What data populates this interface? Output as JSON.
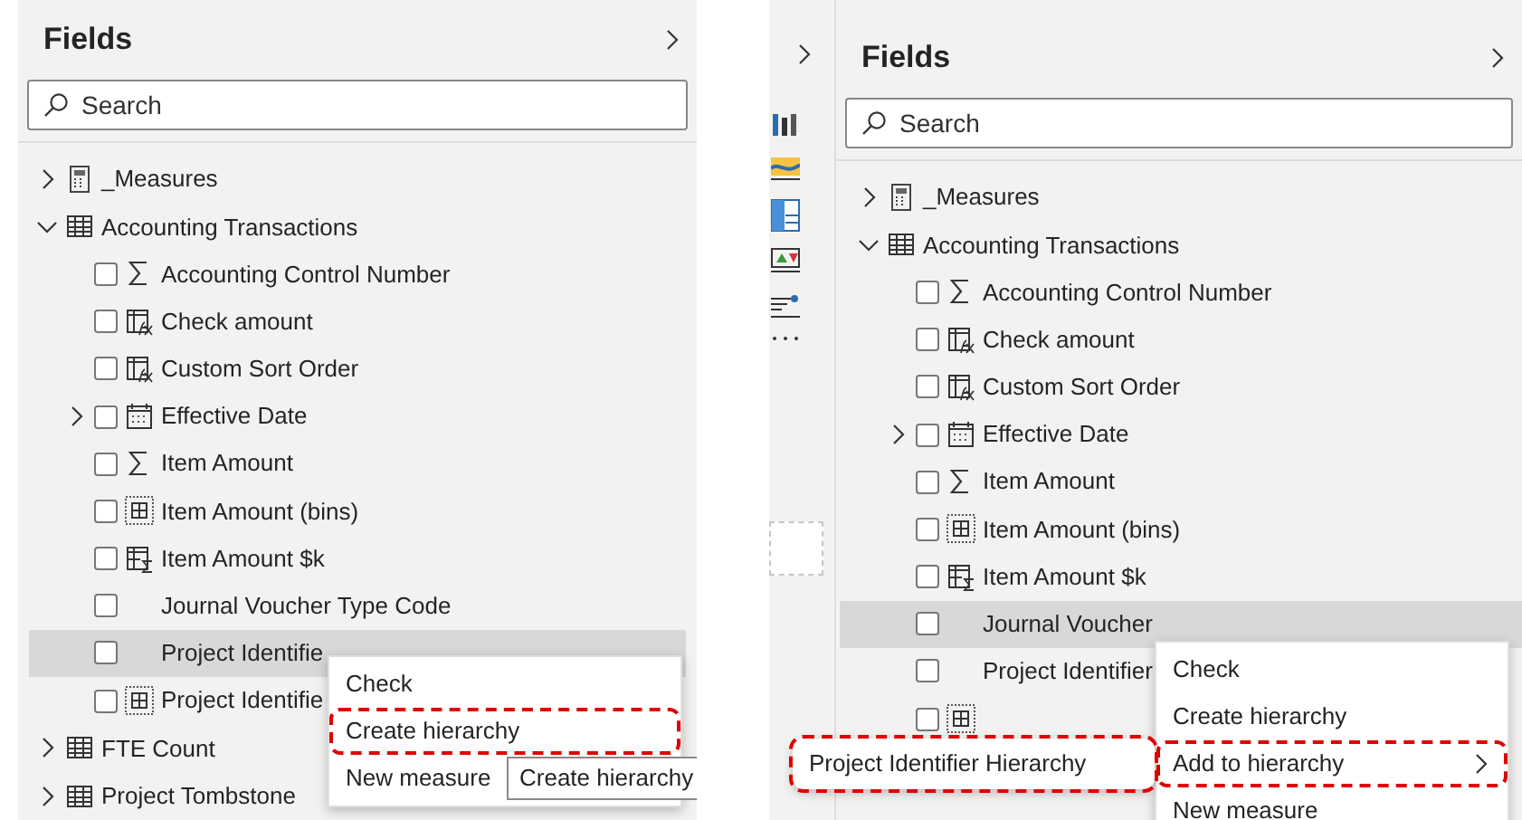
{
  "panels": [
    {
      "kind": "plain",
      "title": "Fields",
      "search": {
        "placeholder": "Search"
      },
      "tree": [
        {
          "label": "_Measures",
          "kind": "calculator",
          "expanded": false
        },
        {
          "label": "Accounting Transactions",
          "kind": "table",
          "expanded": true,
          "children": [
            {
              "label": "Accounting Control Number",
              "kind": "sigma",
              "checked": false,
              "selected": false
            },
            {
              "label": "Check amount",
              "kind": "calc_column",
              "checked": false,
              "selected": false
            },
            {
              "label": "Custom Sort Order",
              "kind": "calc_column",
              "checked": false,
              "selected": false
            },
            {
              "label": "Effective Date",
              "kind": "calendar",
              "checked": false,
              "selected": false,
              "expandable": true
            },
            {
              "label": "Item Amount",
              "kind": "sigma",
              "checked": false,
              "selected": false
            },
            {
              "label": "Item Amount (bins)",
              "kind": "bins",
              "checked": false,
              "selected": false
            },
            {
              "label": "Item Amount $k",
              "kind": "measure",
              "checked": false,
              "selected": false
            },
            {
              "label": "Journal Voucher Type Code",
              "kind": "plain",
              "checked": false,
              "selected": false
            },
            {
              "label": "Project Identifie",
              "kind": "plain",
              "checked": false,
              "selected": true
            },
            {
              "label": "Project Identifie",
              "kind": "bins",
              "checked": false,
              "selected": false
            }
          ]
        },
        {
          "label": "FTE Count",
          "kind": "table",
          "expanded": false
        },
        {
          "label": "Project Tombstone",
          "kind": "table",
          "expanded": false
        }
      ],
      "menu": {
        "items": [
          {
            "label": "Check",
            "outlined": false
          },
          {
            "label": "Create hierarchy",
            "outlined": true
          },
          {
            "label": "New measure",
            "outlined": false
          }
        ]
      },
      "tooltip": "Create hierarchy"
    },
    {
      "kind": "with_pane",
      "title": "Fields",
      "search": {
        "placeholder": "Search"
      },
      "tree": [
        {
          "label": "_Measures",
          "kind": "calculator",
          "expanded": false
        },
        {
          "label": "Accounting Transactions",
          "kind": "table",
          "expanded": true,
          "children": [
            {
              "label": "Accounting Control Number",
              "kind": "sigma",
              "checked": false,
              "selected": false
            },
            {
              "label": "Check amount",
              "kind": "calc_column",
              "checked": false,
              "selected": false
            },
            {
              "label": "Custom Sort Order",
              "kind": "calc_column",
              "checked": false,
              "selected": false
            },
            {
              "label": "Effective Date",
              "kind": "calendar",
              "checked": false,
              "selected": false,
              "expandable": true
            },
            {
              "label": "Item Amount",
              "kind": "sigma",
              "checked": false,
              "selected": false
            },
            {
              "label": "Item Amount (bins)",
              "kind": "bins",
              "checked": false,
              "selected": false
            },
            {
              "label": "Item Amount $k",
              "kind": "measure",
              "checked": false,
              "selected": false
            },
            {
              "label": "Journal Voucher",
              "kind": "plain",
              "checked": false,
              "selected": true
            },
            {
              "label": "Project Identifier",
              "kind": "plain",
              "checked": false,
              "selected": false
            },
            {
              "kind": "bins",
              "checked": false,
              "selected": false
            }
          ]
        }
      ],
      "menu": {
        "items": [
          {
            "label": "Check",
            "outlined": false,
            "submenu": false
          },
          {
            "label": "Create hierarchy",
            "outlined": false,
            "submenu": false
          },
          {
            "label": "Add to hierarchy",
            "outlined": true,
            "submenu": true
          },
          {
            "label": "New measure",
            "outlined": false,
            "submenu": false
          }
        ]
      },
      "submenu": {
        "items": [
          "Project Identifier Hierarchy"
        ]
      }
    }
  ]
}
